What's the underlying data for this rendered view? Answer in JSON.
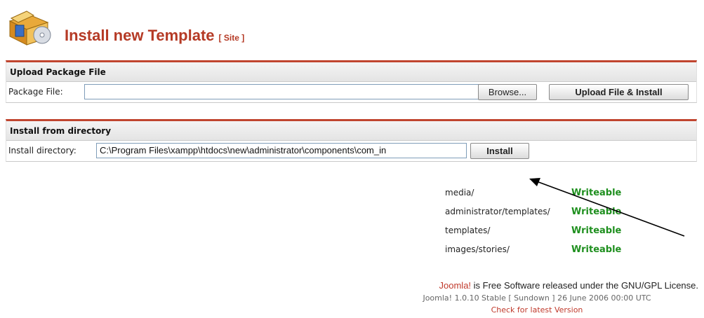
{
  "header": {
    "title": "Install new Template",
    "subtitle": "[ Site ]"
  },
  "upload": {
    "section_title": "Upload Package File",
    "field_label": "Package File:",
    "field_value": "",
    "browse_label": "Browse...",
    "upload_label": "Upload File & Install"
  },
  "directory": {
    "section_title": "Install from directory",
    "field_label": "Install directory:",
    "field_value": "C:\\Program Files\\xampp\\htdocs\\new\\administrator\\components\\com_in",
    "install_label": "Install"
  },
  "writable_dirs": [
    {
      "path": "media/",
      "status": "Writeable"
    },
    {
      "path": "administrator/templates/",
      "status": "Writeable"
    },
    {
      "path": "templates/",
      "status": "Writeable"
    },
    {
      "path": "images/stories/",
      "status": "Writeable"
    }
  ],
  "footer": {
    "brand": "Joomla!",
    "license_text": " is Free Software released under the GNU/GPL License.",
    "version": "Joomla! 1.0.10 Stable [ Sundown ] 26 June 2006 00:00 UTC",
    "check_link": "Check for latest Version"
  },
  "colors": {
    "accent": "#b53a25",
    "status_ok": "#1e8f1e",
    "link": "#c0392b"
  },
  "icons": {
    "header": "package-install-icon",
    "annotation": "arrow-pointer"
  }
}
